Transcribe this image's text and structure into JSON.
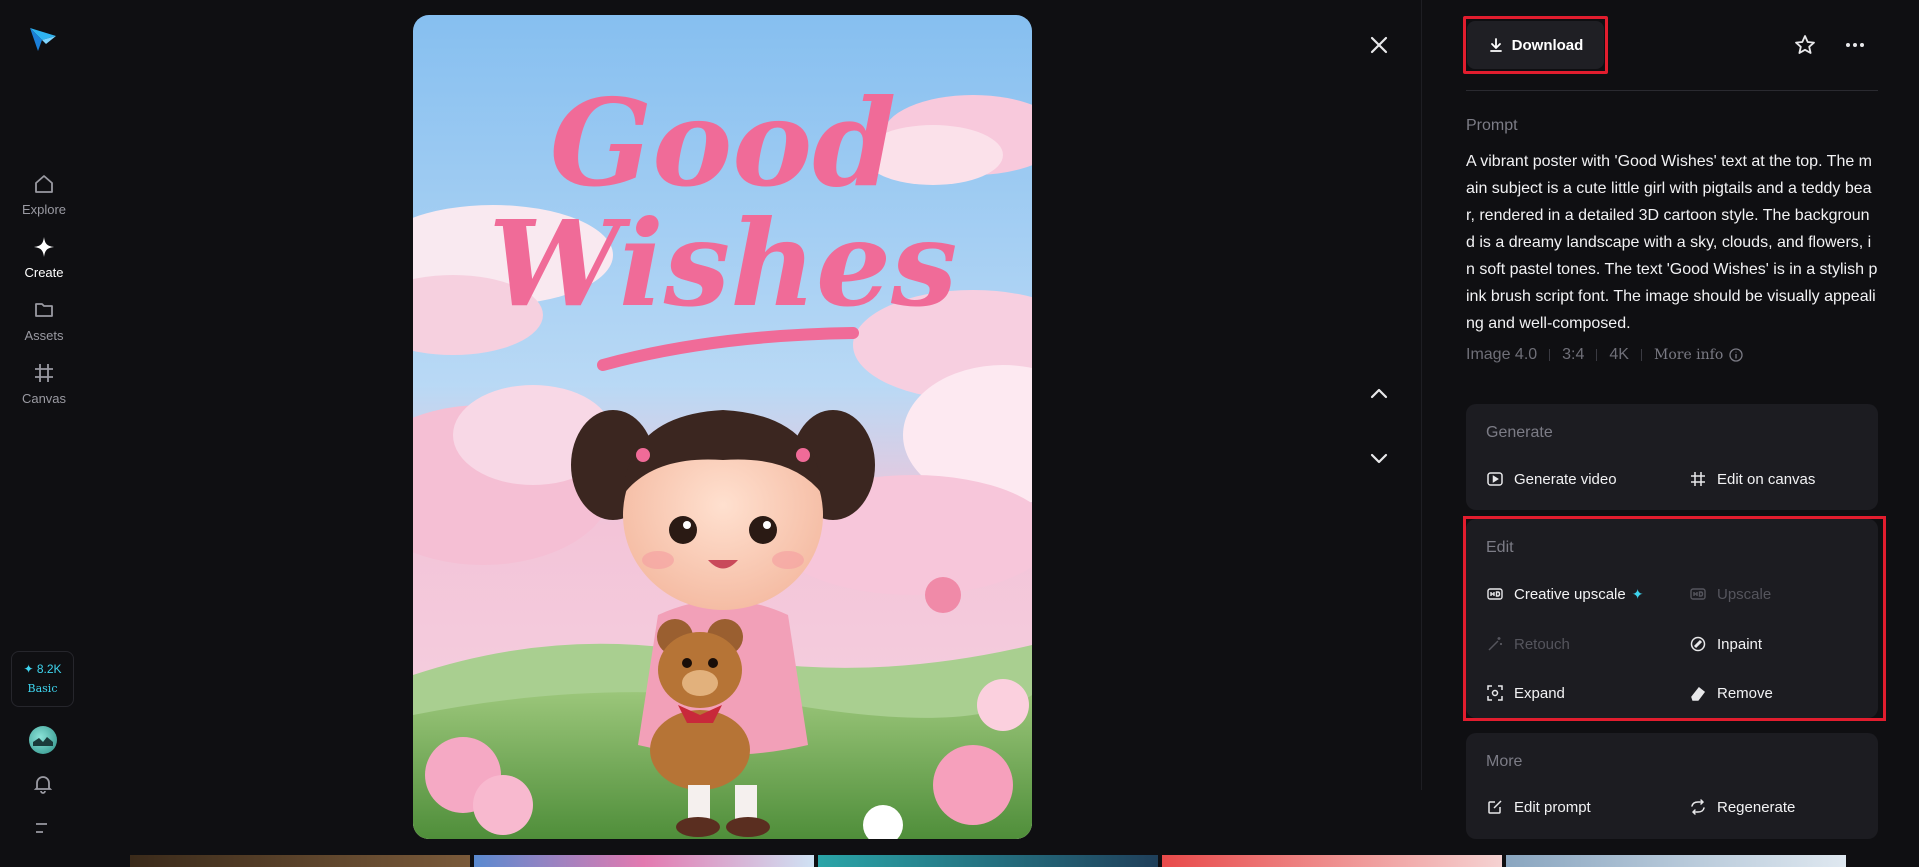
{
  "sidebar": {
    "logo": "paper-plane-logo",
    "items": [
      {
        "label": "Explore",
        "icon": "home-icon"
      },
      {
        "label": "Create",
        "icon": "diamond-sparkle-icon"
      },
      {
        "label": "Assets",
        "icon": "folder-icon"
      },
      {
        "label": "Canvas",
        "icon": "canvas-frame-icon"
      }
    ],
    "credits": {
      "value": "✦ 8.2K",
      "tier": "Basic"
    }
  },
  "image": {
    "poster_text_line1": "Good",
    "poster_text_line2": "Wishes"
  },
  "panel": {
    "download_label": "Download",
    "prompt_label": "Prompt",
    "prompt_text": "A vibrant poster with 'Good Wishes' text at the top. The main subject is a cute little girl with pigtails and a teddy bear, rendered in a detailed 3D cartoon style. The background is a dreamy landscape with a sky, clouds, and flowers, in soft pastel tones. The text 'Good Wishes' is in a stylish pink brush script font. The image should be visually appealing and well-composed.",
    "meta": {
      "model": "Image 4.0",
      "ratio": "3:4",
      "resolution": "4K",
      "more_info": "More info"
    },
    "generate": {
      "title": "Generate",
      "video": "Generate video",
      "canvas": "Edit on canvas"
    },
    "edit": {
      "title": "Edit",
      "creative_upscale": "Creative upscale",
      "upscale": "Upscale",
      "retouch": "Retouch",
      "inpaint": "Inpaint",
      "expand": "Expand",
      "remove": "Remove"
    },
    "more": {
      "title": "More",
      "edit_prompt": "Edit prompt",
      "regenerate": "Regenerate"
    }
  },
  "colors": {
    "accent": "#3ed4ee",
    "highlight": "#e21d2e",
    "pink": "#f06b98"
  }
}
